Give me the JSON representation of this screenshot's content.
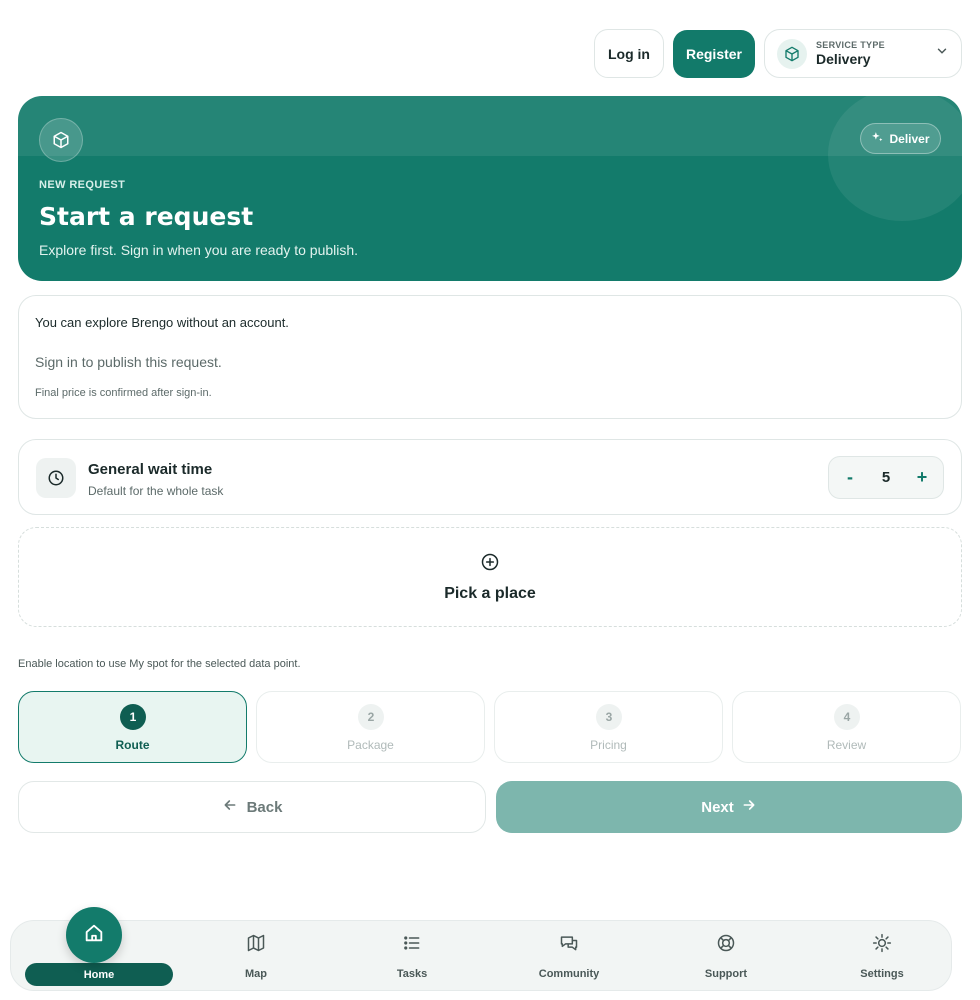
{
  "header": {
    "login_label": "Log in",
    "register_label": "Register",
    "service_type": {
      "label": "SERVICE TYPE",
      "value": "Delivery"
    }
  },
  "hero": {
    "eyebrow": "NEW REQUEST",
    "title": "Start a request",
    "subtitle": "Explore first. Sign in when you are ready to publish.",
    "chip_label": "Deliver"
  },
  "info": {
    "line1": "You can explore Brengo without an account.",
    "line2": "Sign in to publish this request.",
    "line3": "Final price is confirmed after sign-in."
  },
  "wait": {
    "title": "General wait time",
    "subtitle": "Default for the whole task",
    "minus": "-",
    "value": "5",
    "plus": "+"
  },
  "pick": {
    "label": "Pick a place"
  },
  "hint": "Enable location to use My spot for the selected data point.",
  "steps": [
    {
      "num": "1",
      "label": "Route"
    },
    {
      "num": "2",
      "label": "Package"
    },
    {
      "num": "3",
      "label": "Pricing"
    },
    {
      "num": "4",
      "label": "Review"
    }
  ],
  "actions": {
    "back_label": "Back",
    "next_label": "Next"
  },
  "bottom_nav": [
    {
      "label": "Home",
      "icon": "home-icon"
    },
    {
      "label": "Map",
      "icon": "map-icon"
    },
    {
      "label": "Tasks",
      "icon": "list-icon"
    },
    {
      "label": "Community",
      "icon": "chat-icon"
    },
    {
      "label": "Support",
      "icon": "lifebuoy-icon"
    },
    {
      "label": "Settings",
      "icon": "sun-gear-icon"
    }
  ],
  "colors": {
    "brand": "#137b6b",
    "brand_dark": "#0f5e52",
    "next_disabled": "#7db6ad"
  }
}
